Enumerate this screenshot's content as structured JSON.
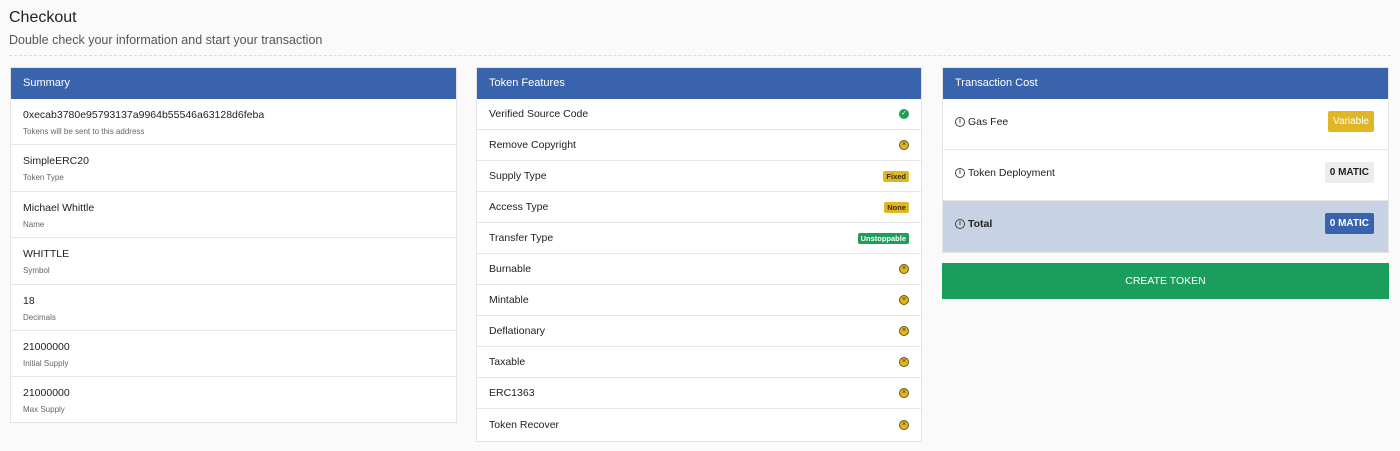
{
  "header": {
    "title": "Checkout",
    "subtitle": "Double check your information and start your transaction"
  },
  "summary": {
    "title": "Summary",
    "rows": [
      {
        "value": "0xecab3780e95793137a9964b55546a63128d6feba",
        "caption": "Tokens will be sent to this address"
      },
      {
        "value": "SimpleERC20",
        "caption": "Token Type"
      },
      {
        "value": "Michael Whittle",
        "caption": "Name"
      },
      {
        "value": "WHITTLE",
        "caption": "Symbol"
      },
      {
        "value": "18",
        "caption": "Decimals"
      },
      {
        "value": "21000000",
        "caption": "Initial Supply"
      },
      {
        "value": "21000000",
        "caption": "Max Supply"
      }
    ]
  },
  "features": {
    "title": "Token Features",
    "rows": [
      {
        "label": "Verified Source Code",
        "status": "check-icon"
      },
      {
        "label": "Remove Copyright",
        "status": "cross-icon"
      },
      {
        "label": "Supply Type",
        "badge": "Fixed"
      },
      {
        "label": "Access Type",
        "badge": "None"
      },
      {
        "label": "Transfer Type",
        "badge": "Unstoppable"
      },
      {
        "label": "Burnable",
        "status": "cross-icon"
      },
      {
        "label": "Mintable",
        "status": "cross-icon"
      },
      {
        "label": "Deflationary",
        "status": "cross-icon"
      },
      {
        "label": "Taxable",
        "status": "cross-icon"
      },
      {
        "label": "ERC1363",
        "status": "cross-icon"
      },
      {
        "label": "Token Recover",
        "status": "cross-icon"
      }
    ]
  },
  "costs": {
    "title": "Transaction Cost",
    "gas_label": "Gas Fee",
    "gas_value": "Variable",
    "deploy_label": "Token Deployment",
    "deploy_value": "0 MATIC",
    "total_label": "Total",
    "total_value": "0 MATIC"
  },
  "create_button": "CREATE TOKEN",
  "colors": {
    "primary": "#3a63ad",
    "success": "#1b9e5c",
    "warning": "#e1b625"
  }
}
